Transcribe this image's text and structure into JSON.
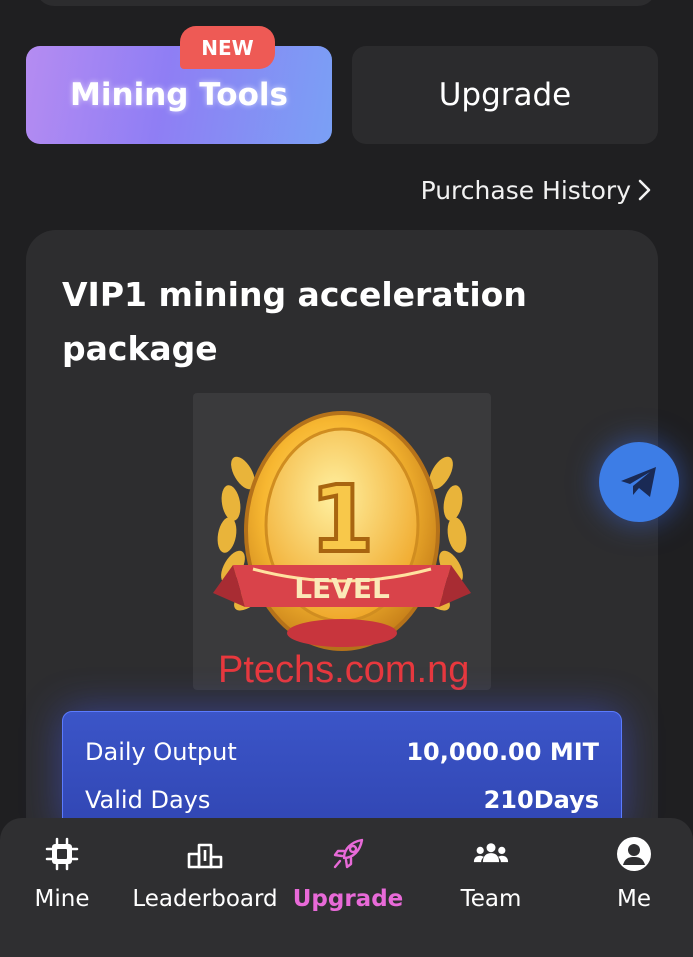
{
  "tabs": {
    "mining_tools": "Mining Tools",
    "new_badge": "NEW",
    "upgrade": "Upgrade"
  },
  "purchase_history": "Purchase History",
  "package": {
    "title": "VIP1 mining acceleration package",
    "medal_number": "1",
    "medal_ribbon": "LEVEL"
  },
  "watermark": "Ptechs.com.ng",
  "stats": {
    "daily_output_label": "Daily Output",
    "daily_output_value": "10,000.00 MIT",
    "valid_days_label": "Valid Days",
    "valid_days_value": "210Days"
  },
  "nav": {
    "mine": "Mine",
    "leaderboard": "Leaderboard",
    "upgrade": "Upgrade",
    "team": "Team",
    "me": "Me"
  },
  "colors": {
    "background": "#1f1f21",
    "card": "#2d2d2f",
    "active_nav": "#e86ad8",
    "stats_panel": "#3b55c8",
    "badge": "#ee5a55",
    "telegram": "#3d7de6"
  }
}
